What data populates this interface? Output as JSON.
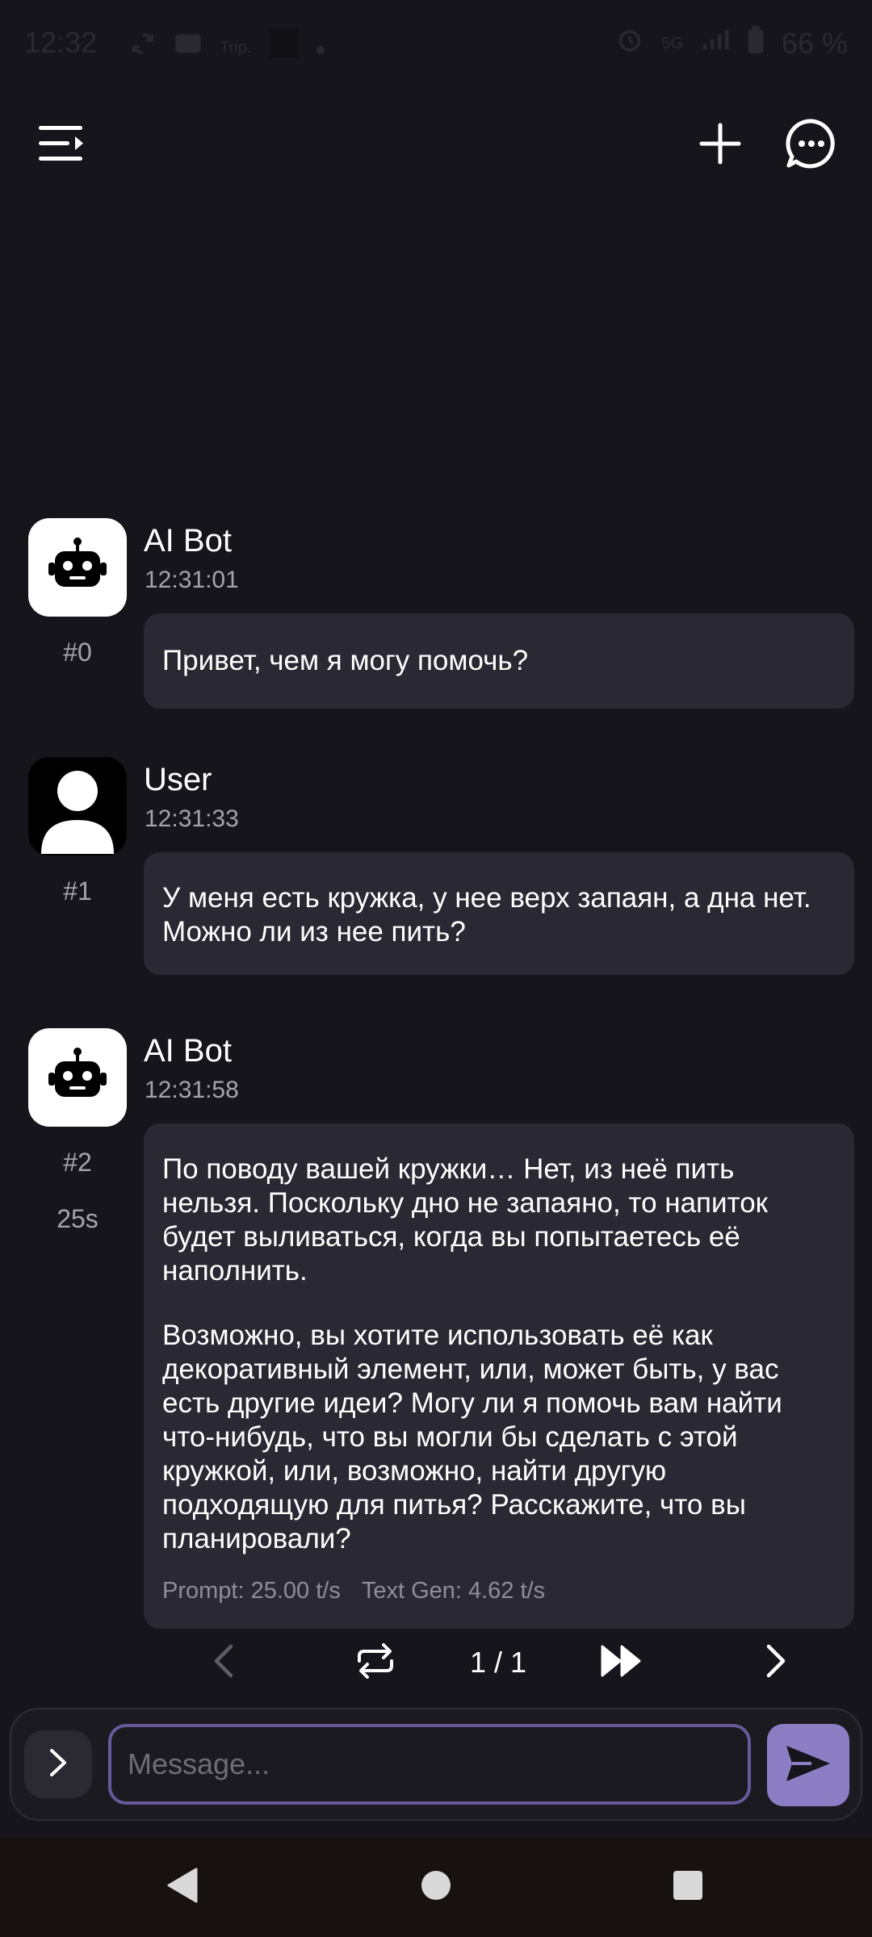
{
  "status_bar": {
    "time": "12:32",
    "carrier": "Trip.",
    "network": "5G",
    "signal_label": "1",
    "battery": "66 %"
  },
  "top_bar": {
    "menu_icon": "menu-icon",
    "new_chat_icon": "plus-icon",
    "chats_icon": "chat-bubble-icon"
  },
  "messages": [
    {
      "sender": "AI Bot",
      "avatar": "robot-icon",
      "time": "12:31:01",
      "index": "#0",
      "paragraphs": [
        "Привет, чем я могу помочь?"
      ]
    },
    {
      "sender": "User",
      "avatar": "user-icon",
      "time": "12:31:33",
      "index": "#1",
      "paragraphs": [
        "У меня есть кружка, у нее верх запаян, а дна нет. Можно ли из нее пить?"
      ]
    },
    {
      "sender": "AI Bot",
      "avatar": "robot-icon",
      "time": "12:31:58",
      "index": "#2",
      "duration": "25s",
      "paragraphs": [
        "По поводу вашей кружки… Нет, из неё пить нельзя. Поскольку дно не запаяно, то напиток будет выливаться, когда вы попытаетесь её наполнить.",
        "Возможно, вы хотите использовать её как декоративный элемент, или, может быть, у вас есть другие идеи? Могу ли я помочь вам найти что-нибудь, что вы могли бы сделать с этой кружкой, или, возможно, найти другую подходящую для питья? Расскажите, что вы планировали?"
      ],
      "prompt_speed": "Prompt: 25.00 t/s",
      "gen_speed": "Text Gen: 4.62 t/s"
    }
  ],
  "swipe_nav": {
    "page": "1 / 1"
  },
  "input": {
    "placeholder": "Message...",
    "value": ""
  },
  "colors": {
    "background": "#16151c",
    "bubble": "#2a2833",
    "accent": "#8c7ec4",
    "input_border": "#675a9a"
  }
}
